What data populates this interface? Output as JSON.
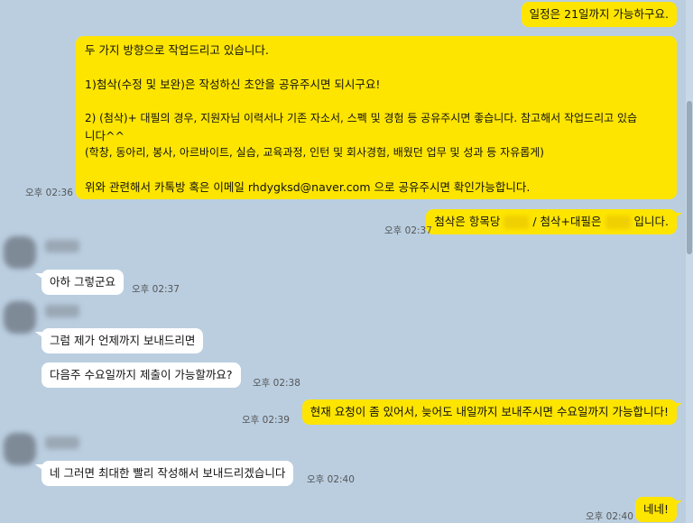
{
  "messages": {
    "m1": {
      "text": "일정은 21일까지 가능하구요."
    },
    "m2": {
      "lines": [
        "두 가지 방향으로 작업드리고 있습니다.",
        "",
        "1)첨삭(수정 및 보완)은 작성하신 초안을 공유주시면 되시구요!",
        "",
        "2) (첨삭)+ 대필의 경우, 지원자님 이력서나 기존 자소서, 스펙 및 경험 등 공유주시면 좋습니다. 참고해서 작업드리고 있습",
        "니다^^",
        "(학창, 동아리, 봉사, 아르바이트, 실습, 교육과정, 인턴 및 회사경험, 배웠던 업무 및 성과 등 자유롭게)",
        "",
        "위와 관련해서 카톡방 혹은 이메일 rhdygksd@naver.com 으로 공유주시면 확인가능합니다."
      ],
      "time": "오후 02:36"
    },
    "m3": {
      "part1": "첨삭은 항목당",
      "part2": "/ 첨삭+대필은",
      "part3": "입니다.",
      "time": "오후 02:37"
    },
    "m4": {
      "text": "아하 그렇군요",
      "time": "오후 02:37"
    },
    "m5": {
      "text": "그럼 제가 언제까지 보내드리면"
    },
    "m6": {
      "text": "다음주 수요일까지 제출이 가능할까요?",
      "time": "오후 02:38"
    },
    "m7": {
      "text": "현재 요청이 좀 있어서, 늦어도 내일까지 보내주시면 수요일까지 가능합니다!",
      "time": "오후 02:39"
    },
    "m8": {
      "text": "네 그러면 최대한 빨리 작성해서 보내드리겠습니다",
      "time": "오후 02:40"
    },
    "m9": {
      "text": "네네!",
      "time": "오후 02:40"
    }
  },
  "colors": {
    "background": "#bacee0",
    "my_bubble": "#fee500",
    "other_bubble": "#ffffff"
  }
}
